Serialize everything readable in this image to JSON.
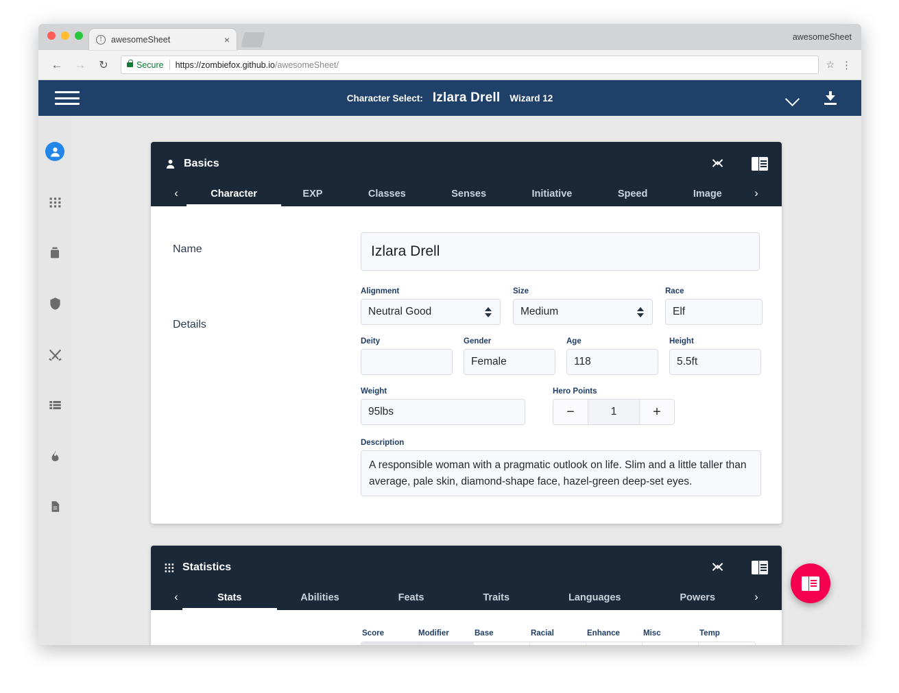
{
  "browser": {
    "tab_title": "awesomeSheet",
    "tab_favicon": "info-circle-icon",
    "window_title": "awesomeSheet",
    "close_label": "×",
    "back_label": "←",
    "forward_label": "→",
    "reload_label": "↻",
    "secure_label": "Secure",
    "url_domain": "https://zombiefox.github.io",
    "url_path": "/awesomeSheet/",
    "star_label": "☆",
    "menu_label": "⋮"
  },
  "app_header": {
    "menu_icon": "hamburger-icon",
    "character_select_label": "Character Select:",
    "character_name": "Izlara Drell",
    "character_class": "Wizard 12",
    "dropdown_icon": "chevron-down-icon",
    "download_icon": "download-icon"
  },
  "sidebar": {
    "items": [
      {
        "name": "character",
        "icon": "person-icon",
        "active": true
      },
      {
        "name": "statistics",
        "icon": "grid-dots-icon",
        "active": false
      },
      {
        "name": "equipment",
        "icon": "bag-icon",
        "active": false
      },
      {
        "name": "defense",
        "icon": "shield-icon",
        "active": false
      },
      {
        "name": "combat",
        "icon": "crossed-swords-icon",
        "active": false
      },
      {
        "name": "inventory",
        "icon": "list-icon",
        "active": false
      },
      {
        "name": "spells",
        "icon": "flame-icon",
        "active": false
      },
      {
        "name": "notes",
        "icon": "document-icon",
        "active": false
      }
    ]
  },
  "basics_card": {
    "icon": "person-icon",
    "title": "Basics",
    "collapse_icon": "collapse-icon",
    "book_icon": "book-panel-icon",
    "prev_label": "‹",
    "next_label": "›",
    "tabs": [
      {
        "label": "Character",
        "active": true
      },
      {
        "label": "EXP",
        "active": false
      },
      {
        "label": "Classes",
        "active": false
      },
      {
        "label": "Senses",
        "active": false
      },
      {
        "label": "Initiative",
        "active": false
      },
      {
        "label": "Speed",
        "active": false
      },
      {
        "label": "Image",
        "active": false
      }
    ],
    "name_row_label": "Name",
    "name_value": "Izlara Drell",
    "details_row_label": "Details",
    "fields_row1": [
      {
        "label": "Alignment",
        "value": "Neutral Good",
        "type": "select"
      },
      {
        "label": "Size",
        "value": "Medium",
        "type": "select"
      },
      {
        "label": "Race",
        "value": "Elf",
        "type": "text"
      }
    ],
    "fields_row2": [
      {
        "label": "Deity",
        "value": "",
        "type": "text"
      },
      {
        "label": "Gender",
        "value": "Female",
        "type": "text"
      },
      {
        "label": "Age",
        "value": "118",
        "type": "text"
      },
      {
        "label": "Height",
        "value": "5.5ft",
        "type": "text"
      }
    ],
    "weight_label": "Weight",
    "weight_value": "95lbs",
    "hero_points_label": "Hero Points",
    "hero_points_value": "1",
    "hero_points_minus": "−",
    "hero_points_plus": "+",
    "description_label": "Description",
    "description_value": "A responsible woman with a pragmatic outlook on life. Slim and a little taller than average, pale skin, diamond-shape face, hazel-green deep-set eyes."
  },
  "statistics_card": {
    "icon": "grid-dots-icon",
    "title": "Statistics",
    "collapse_icon": "collapse-icon",
    "book_icon": "book-panel-icon",
    "prev_label": "‹",
    "next_label": "›",
    "tabs": [
      {
        "label": "Stats",
        "active": true
      },
      {
        "label": "Abilities",
        "active": false
      },
      {
        "label": "Feats",
        "active": false
      },
      {
        "label": "Traits",
        "active": false
      },
      {
        "label": "Languages",
        "active": false
      },
      {
        "label": "Powers",
        "active": false
      }
    ],
    "columns": [
      "Score",
      "Modifier",
      "Base",
      "Racial",
      "Enhance",
      "Misc",
      "Temp"
    ],
    "first_row": [
      "",
      "",
      "",
      "",
      "",
      "",
      ""
    ]
  },
  "fab": {
    "icon": "book-panel-icon",
    "color": "#f50050"
  },
  "colors": {
    "app_header": "#1f4068",
    "card_header": "#1b2838",
    "accent_blue": "#2287e8",
    "page_bg": "#e8e8e8",
    "field_bg": "#f8f9fc",
    "label_blue": "#1f3d66"
  }
}
